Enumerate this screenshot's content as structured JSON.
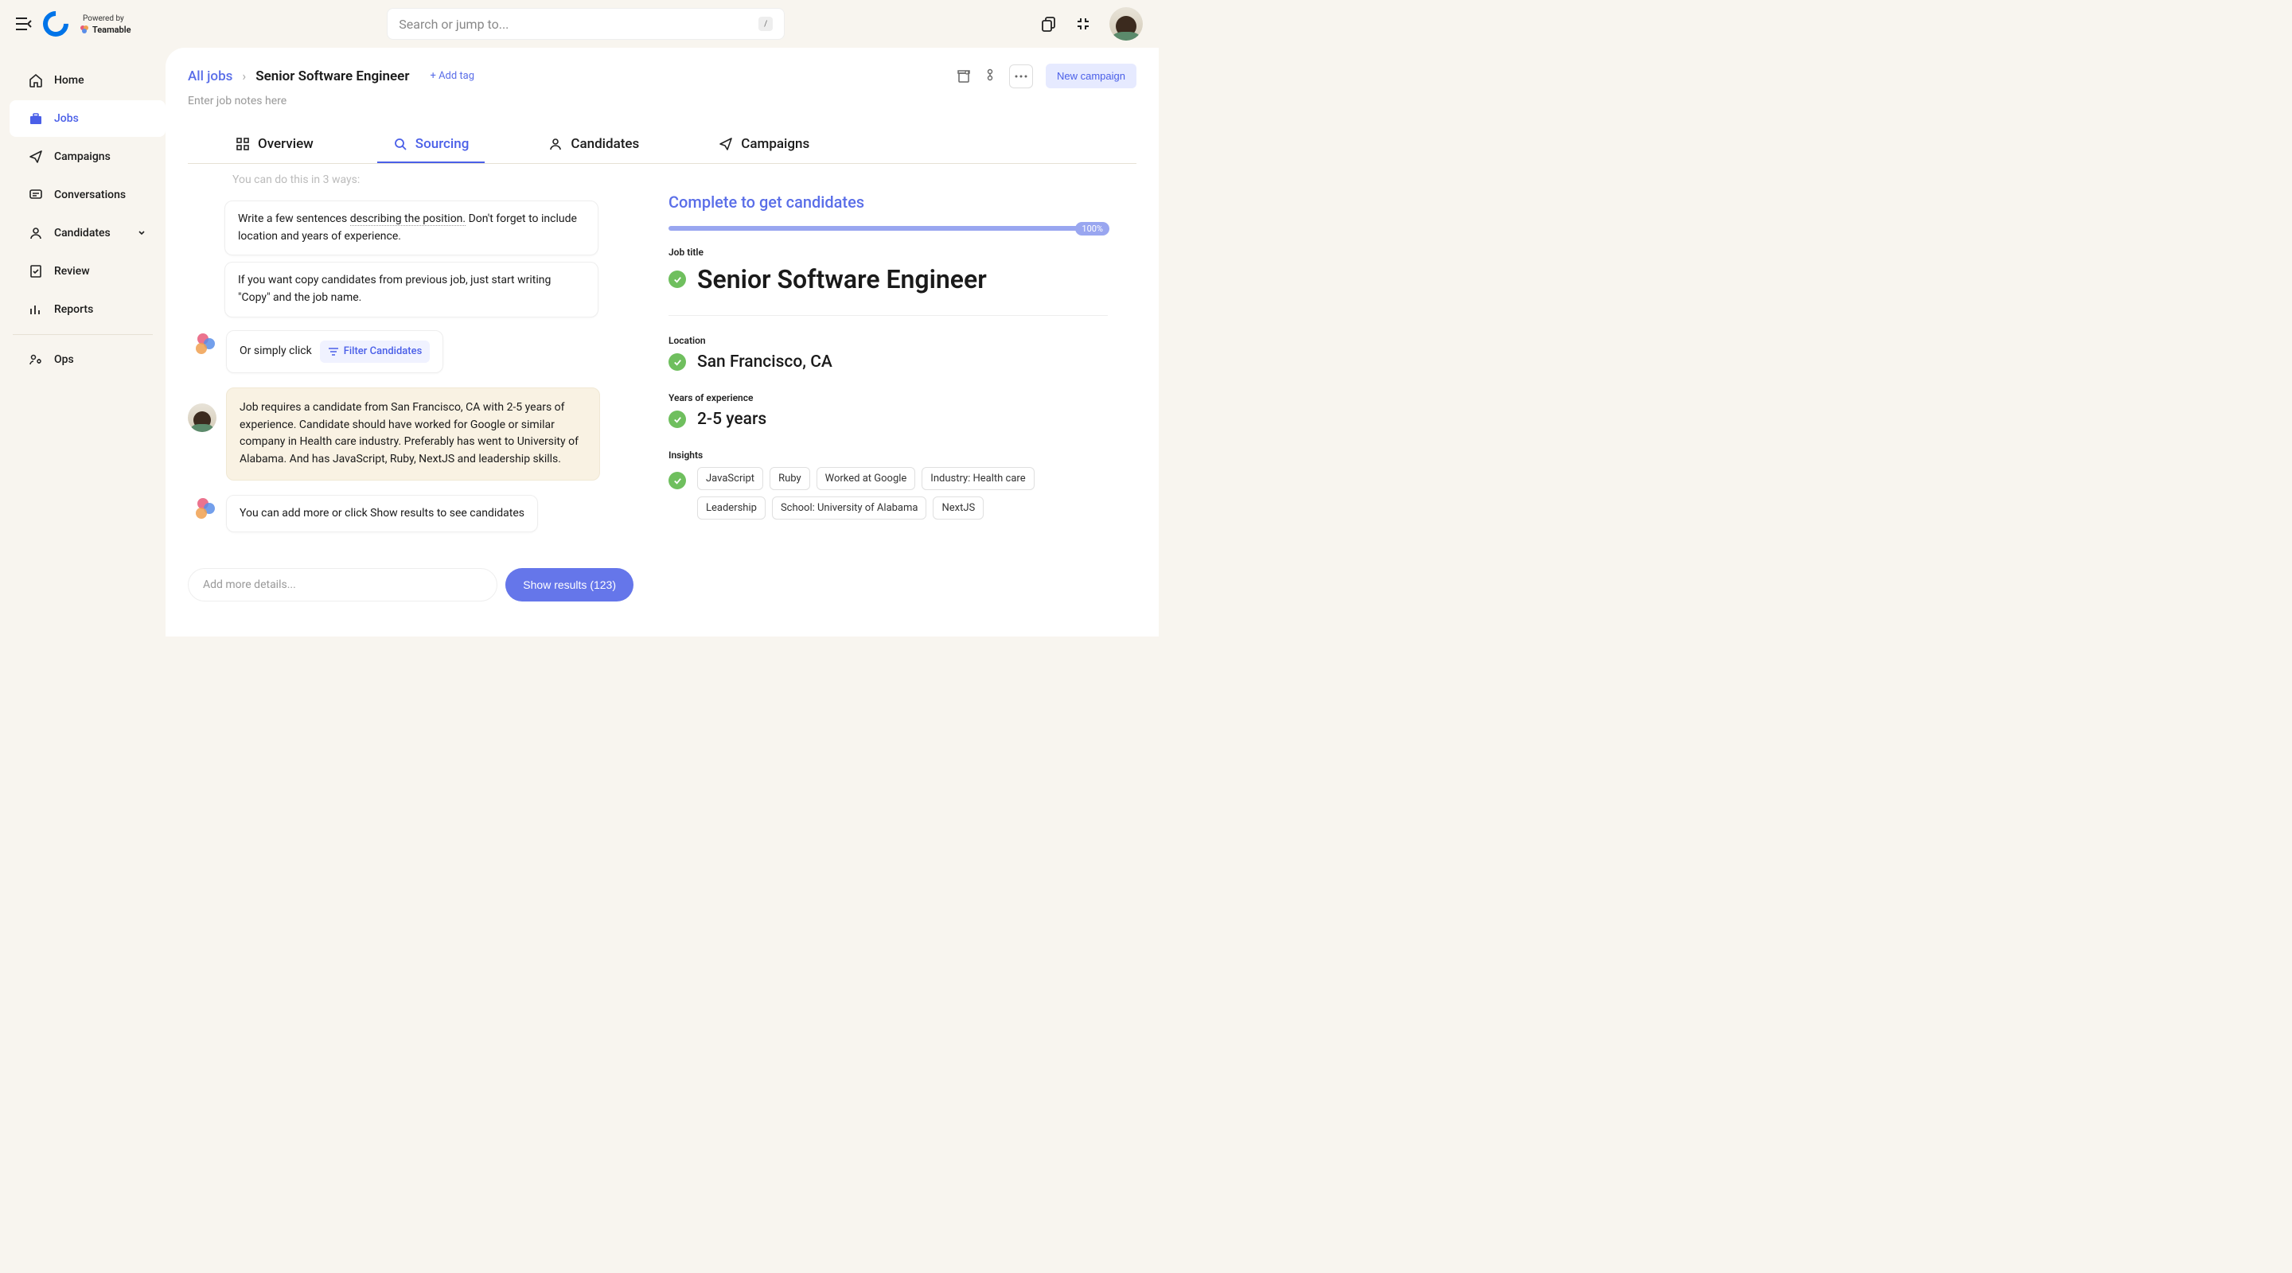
{
  "header": {
    "powered_by": "Powered by",
    "brand": "Teamable",
    "search_placeholder": "Search or jump to...",
    "slash": "/"
  },
  "sidebar": {
    "items": [
      {
        "label": "Home"
      },
      {
        "label": "Jobs"
      },
      {
        "label": "Campaigns"
      },
      {
        "label": "Conversations"
      },
      {
        "label": "Candidates"
      },
      {
        "label": "Review"
      },
      {
        "label": "Reports"
      },
      {
        "label": "Ops"
      }
    ]
  },
  "breadcrumb": {
    "root": "All jobs",
    "current": "Senior Software Engineer",
    "add_tag": "Add tag",
    "notes_placeholder": "Enter job notes here",
    "new_campaign": "New campaign"
  },
  "tabs": [
    {
      "label": "Overview"
    },
    {
      "label": "Sourcing"
    },
    {
      "label": "Candidates"
    },
    {
      "label": "Campaigns"
    }
  ],
  "chat": {
    "faded": "You can do this in 3 ways:",
    "msg1_a": "Write a few sentences ",
    "msg1_b": "describing the position.",
    "msg1_c": " Don't forget to include location and years of experience.",
    "msg2": "If you want copy candidates from previous job, just start writing \"Copy\" and the job name.",
    "msg3": "Or simply click",
    "filter_link": "Filter Candidates",
    "user_msg": "Job requires a candidate from San Francisco, CA with 2-5 years of experience. Candidate should have worked for Google or similar company in Health care industry. Preferably has went to University of Alabama. And has JavaScript, Ruby, NextJS and leadership skills.",
    "msg4": "You can add more or click Show results to see candidates",
    "input_placeholder": "Add more details...",
    "show_results": "Show results (123)"
  },
  "detail": {
    "complete_title": "Complete to get candidates",
    "progress": "100%",
    "fields": {
      "job_title_label": "Job title",
      "job_title_value": "Senior Software Engineer",
      "location_label": "Location",
      "location_value": "San Francisco, CA",
      "years_label": "Years of experience",
      "years_value": "2-5 years",
      "insights_label": "Insights"
    },
    "tags": [
      "JavaScript",
      "Ruby",
      "Worked at Google",
      "Industry: Health care",
      "Leadership",
      "School: University of Alabama",
      "NextJS"
    ]
  }
}
